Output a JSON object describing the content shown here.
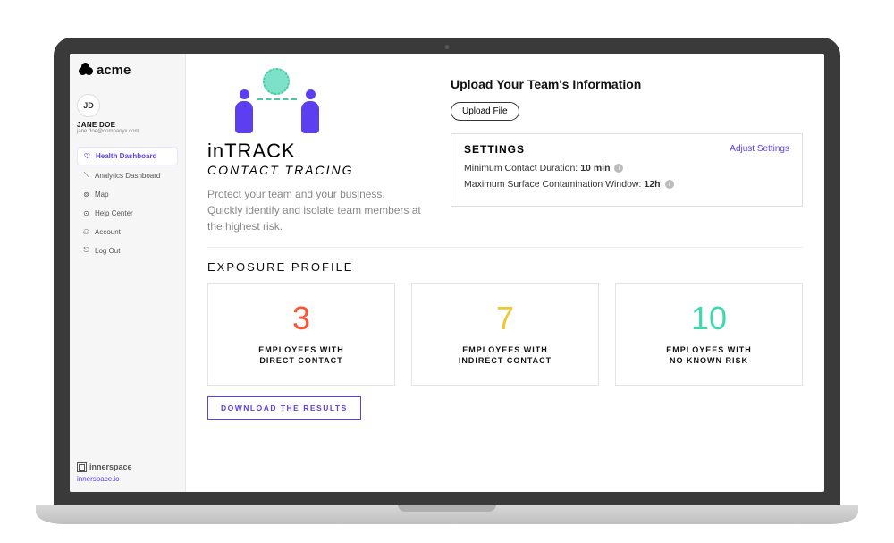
{
  "logo_text": "acme",
  "user": {
    "initials": "JD",
    "name": "JANE DOE",
    "email": "jane.doe@companyx.com"
  },
  "nav": [
    {
      "label": "Health Dashboard",
      "icon": "♡"
    },
    {
      "label": "Analytics Dashboard",
      "icon": "⟍"
    },
    {
      "label": "Map",
      "icon": "⊚"
    },
    {
      "label": "Help Center",
      "icon": "⊙"
    },
    {
      "label": "Account",
      "icon": "⚇"
    },
    {
      "label": "Log Out",
      "icon": "⎋"
    }
  ],
  "footer": {
    "brand": "innerspace",
    "link": "innerspace.io"
  },
  "hero": {
    "title": "inTRACK",
    "subtitle": "CONTACT TRACING",
    "desc": "Protect your team and your business. Quickly identify and isolate team members at the highest risk."
  },
  "upload": {
    "title": "Upload Your Team's Information",
    "button": "Upload File"
  },
  "settings": {
    "title": "SETTINGS",
    "adjust": "Adjust Settings",
    "rows": [
      {
        "label": "Minimum Contact Duration:",
        "value": "10 min"
      },
      {
        "label": "Maximum Surface Contamination Window:",
        "value": "12h"
      }
    ]
  },
  "exposure": {
    "title": "EXPOSURE PROFILE",
    "cards": [
      {
        "num": "3",
        "label_l1": "EMPLOYEES WITH",
        "label_l2": "DIRECT CONTACT",
        "color": "c-red"
      },
      {
        "num": "7",
        "label_l1": "EMPLOYEES WITH",
        "label_l2": "INDIRECT CONTACT",
        "color": "c-yellow"
      },
      {
        "num": "10",
        "label_l1": "EMPLOYEES WITH",
        "label_l2": "NO KNOWN RISK",
        "color": "c-green"
      }
    ],
    "download": "DOWNLOAD THE RESULTS"
  }
}
